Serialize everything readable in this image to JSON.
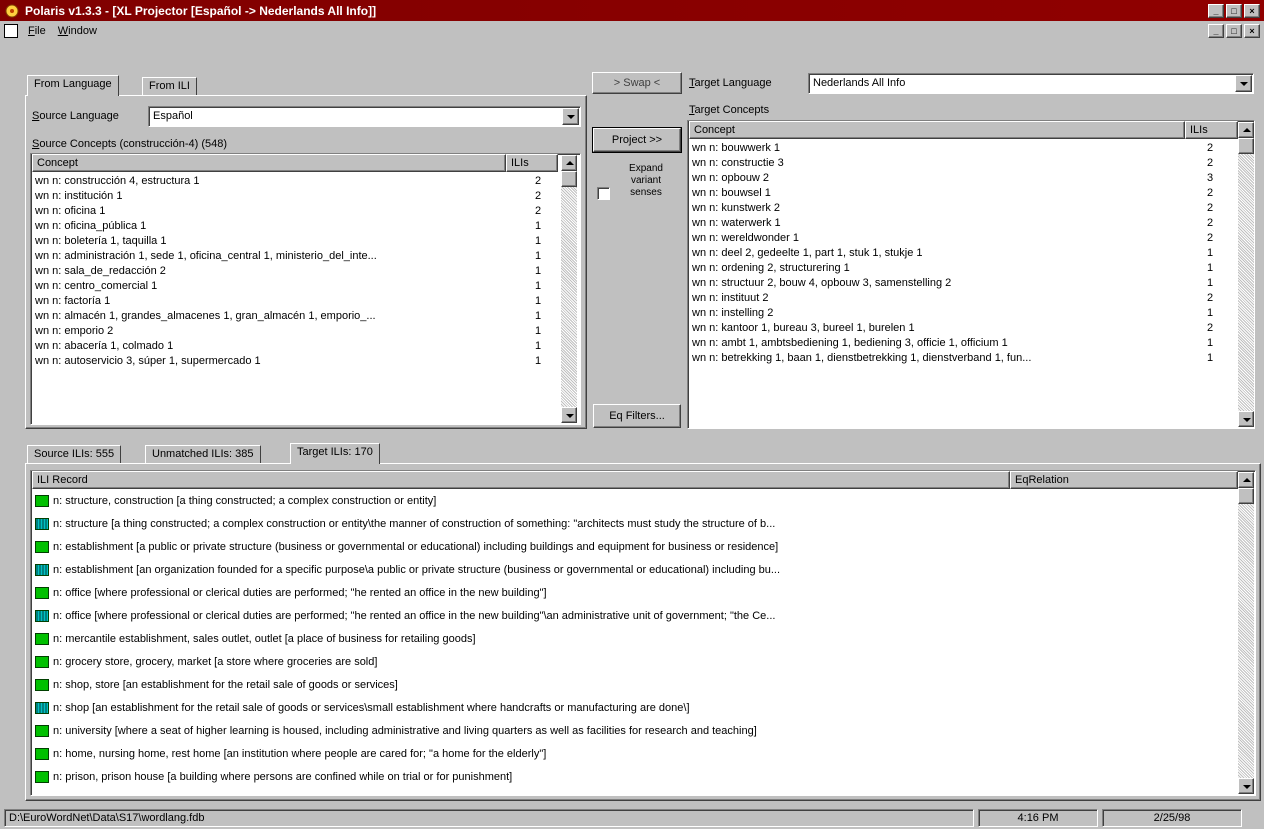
{
  "window": {
    "title": "Polaris v1.3.3 - [XL Projector [Español -> Nederlands All Info]]",
    "min": "_",
    "max": "□",
    "close": "×"
  },
  "menu": {
    "file": "File",
    "window": "Window"
  },
  "left_tabs": [
    "From Language",
    "From ILI"
  ],
  "source": {
    "language_label": "Source Language",
    "language_value": "Español",
    "concepts_label": "Source Concepts (construcción-4) (548)",
    "col_concept": "Concept",
    "col_ilis": "ILIs",
    "rows": [
      {
        "concept": "wn n: construcción 4, estructura 1",
        "ilis": "2"
      },
      {
        "concept": "wn n: institución 1",
        "ilis": "2"
      },
      {
        "concept": "wn n: oficina 1",
        "ilis": "2"
      },
      {
        "concept": "wn n: oficina_pública 1",
        "ilis": "1"
      },
      {
        "concept": "wn n: boletería 1, taquilla 1",
        "ilis": "1"
      },
      {
        "concept": "wn n: administración 1, sede 1, oficina_central 1, ministerio_del_inte...",
        "ilis": "1"
      },
      {
        "concept": "wn n: sala_de_redacción 2",
        "ilis": "1"
      },
      {
        "concept": "wn n: centro_comercial 1",
        "ilis": "1"
      },
      {
        "concept": "wn n: factoría 1",
        "ilis": "1"
      },
      {
        "concept": "wn n: almacén 1, grandes_almacenes 1, gran_almacén 1, emporio_...",
        "ilis": "1"
      },
      {
        "concept": "wn n: emporio 2",
        "ilis": "1"
      },
      {
        "concept": "wn n: abacería 1, colmado 1",
        "ilis": "1"
      },
      {
        "concept": "wn n: autoservicio 3, súper 1, supermercado 1",
        "ilis": "1"
      }
    ]
  },
  "middle": {
    "swap": "> Swap <",
    "project": "Project >>",
    "expand_label": "Expand variant senses",
    "eqfilters": "Eq Filters..."
  },
  "target": {
    "language_label": "Target Language",
    "language_value": "Nederlands All Info",
    "concepts_label": "Target Concepts",
    "col_concept": "Concept",
    "col_ilis": "ILIs",
    "rows": [
      {
        "concept": "wn n: bouwwerk 1",
        "ilis": "2"
      },
      {
        "concept": "wn n: constructie 3",
        "ilis": "2"
      },
      {
        "concept": "wn n: opbouw 2",
        "ilis": "3"
      },
      {
        "concept": "wn n: bouwsel 1",
        "ilis": "2"
      },
      {
        "concept": "wn n: kunstwerk 2",
        "ilis": "2"
      },
      {
        "concept": "wn n: waterwerk 1",
        "ilis": "2"
      },
      {
        "concept": "wn n: wereldwonder 1",
        "ilis": "2"
      },
      {
        "concept": "wn n: deel 2, gedeelte 1, part 1, stuk 1, stukje 1",
        "ilis": "1"
      },
      {
        "concept": "wn n: ordening 2, structurering 1",
        "ilis": "1"
      },
      {
        "concept": "wn n: structuur 2, bouw 4, opbouw 3, samenstelling 2",
        "ilis": "1"
      },
      {
        "concept": "wn n: instituut 2",
        "ilis": "2"
      },
      {
        "concept": "wn n: instelling 2",
        "ilis": "1"
      },
      {
        "concept": "wn n: kantoor 1, bureau 3, bureel 1, burelen 1",
        "ilis": "2"
      },
      {
        "concept": "wn n: ambt 1, ambtsbediening 1, bediening 3, officie 1, officium 1",
        "ilis": "1"
      },
      {
        "concept": "wn n: betrekking 1, baan 1, dienstbetrekking 1, dienstverband 1, fun...",
        "ilis": "1"
      }
    ]
  },
  "bottom_tabs": [
    "Source ILIs: 555",
    "Unmatched ILIs: 385",
    "Target ILIs: 170"
  ],
  "ili": {
    "col_record": "ILI Record",
    "col_relation": "EqRelation",
    "rows": [
      {
        "icon": "green",
        "text": "n: structure, construction [a thing constructed; a complex construction or entity]"
      },
      {
        "icon": "teal",
        "text": "n: structure [a thing constructed; a complex construction or entity\\the manner of construction of something: \"architects must study the structure of b..."
      },
      {
        "icon": "green",
        "text": "n: establishment [a public or private structure (business or governmental or educational) including buildings and equipment for business or residence]"
      },
      {
        "icon": "teal",
        "text": "n: establishment [an organization founded for a specific purpose\\a public or private structure (business or governmental or educational) including bu..."
      },
      {
        "icon": "green",
        "text": "n: office [where professional or clerical duties are performed; \"he rented an office in the new building\"]"
      },
      {
        "icon": "teal",
        "text": "n: office [where professional or clerical duties are performed; \"he rented an office in the new building\"\\an administrative unit of government; \"the Ce..."
      },
      {
        "icon": "green",
        "text": "n: mercantile establishment, sales outlet, outlet [a place of business for retailing goods]"
      },
      {
        "icon": "green",
        "text": "n: grocery store, grocery, market [a store where groceries are sold]"
      },
      {
        "icon": "green",
        "text": "n: shop, store [an establishment for the retail sale of goods or services]"
      },
      {
        "icon": "teal",
        "text": "n: shop [an establishment for the retail sale of goods or services\\small establishment where handcrafts or manufacturing are done\\]"
      },
      {
        "icon": "green",
        "text": "n: university [where a seat of higher learning is housed, including administrative and living quarters as well as facilities for research and teaching]"
      },
      {
        "icon": "green",
        "text": "n: home, nursing home, rest home [an institution where people are cared for; \"a home for the elderly\"]"
      },
      {
        "icon": "green",
        "text": "n: prison, prison house [a building where persons are confined while on trial or for punishment]"
      }
    ]
  },
  "status": {
    "path": "D:\\EuroWordNet\\Data\\S17\\wordlang.fdb",
    "time": "4:16 PM",
    "date": "2/25/98"
  },
  "colors": {
    "titlebar": "#800000",
    "green_icon": "#00c000",
    "teal_icon": "#008080"
  }
}
